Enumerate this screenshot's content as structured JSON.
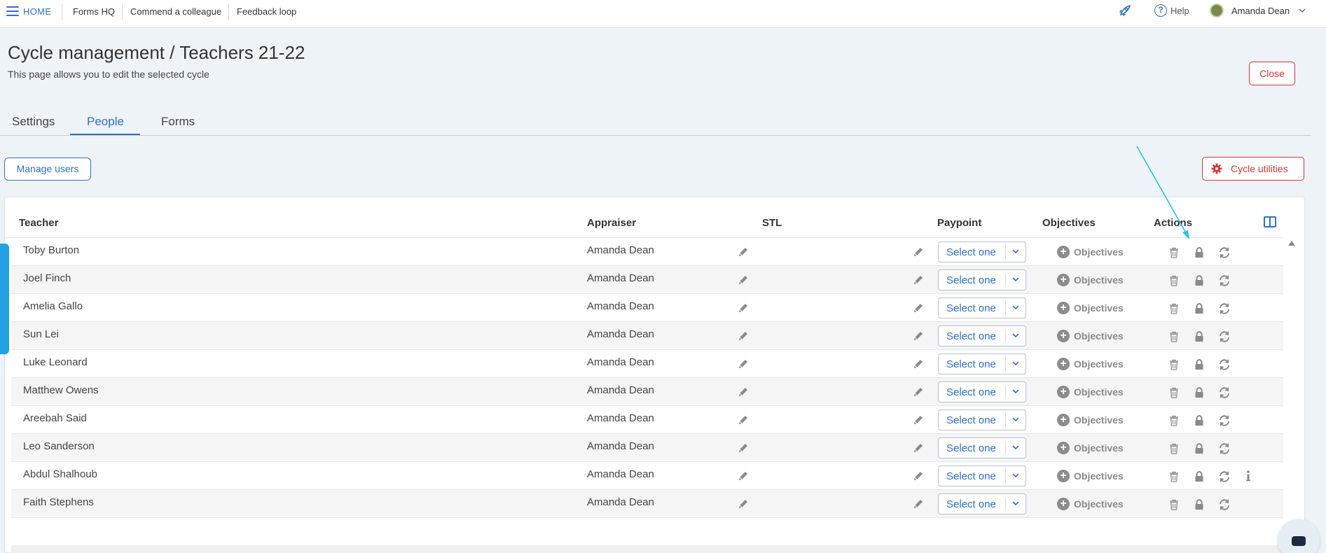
{
  "nav": {
    "home": "HOME",
    "links": [
      "Forms HQ",
      "Commend a colleague",
      "Feedback loop"
    ],
    "help": "Help",
    "user": "Amanda Dean"
  },
  "header": {
    "title": "Cycle management / Teachers 21-22",
    "subtitle": "This page allows you to edit the selected cycle",
    "close": "Close"
  },
  "tabs": [
    "Settings",
    "People",
    "Forms"
  ],
  "active_tab": "People",
  "buttons": {
    "manage_users": "Manage users",
    "cycle_utilities": "Cycle utilities"
  },
  "table": {
    "columns": [
      "Teacher",
      "Appraiser",
      "STL",
      "Paypoint",
      "Objectives",
      "Actions"
    ],
    "select_placeholder": "Select one",
    "objectives_label": "Objectives",
    "rows": [
      {
        "teacher": "Toby Burton",
        "appraiser": "Amanda Dean",
        "stl": "",
        "info": false
      },
      {
        "teacher": "Joel Finch",
        "appraiser": "Amanda Dean",
        "stl": "",
        "info": false
      },
      {
        "teacher": "Amelia Gallo",
        "appraiser": "Amanda Dean",
        "stl": "",
        "info": false
      },
      {
        "teacher": "Sun Lei",
        "appraiser": "Amanda Dean",
        "stl": "",
        "info": false
      },
      {
        "teacher": "Luke Leonard",
        "appraiser": "Amanda Dean",
        "stl": "",
        "info": false
      },
      {
        "teacher": "Matthew Owens",
        "appraiser": "Amanda Dean",
        "stl": "",
        "info": false
      },
      {
        "teacher": "Areebah Said",
        "appraiser": "Amanda Dean",
        "stl": "",
        "info": false
      },
      {
        "teacher": "Leo Sanderson",
        "appraiser": "Amanda Dean",
        "stl": "",
        "info": false
      },
      {
        "teacher": "Abdul Shalhoub",
        "appraiser": "Amanda Dean",
        "stl": "",
        "info": true
      },
      {
        "teacher": "Faith Stephens",
        "appraiser": "Amanda Dean",
        "stl": "",
        "info": false
      }
    ]
  },
  "colors": {
    "accent": "#2f6fcf",
    "danger": "#dd3333",
    "side_tab": "#1fa1e3",
    "annotation_arrow": "#1ec8e8"
  },
  "icons": [
    "menu-icon",
    "rocket-icon",
    "help-icon",
    "chevron-down-icon",
    "gear-icon",
    "columns-icon",
    "pencil-icon",
    "plus-circle-icon",
    "trash-icon",
    "lock-icon",
    "refresh-icon",
    "info-icon",
    "chat-icon"
  ]
}
